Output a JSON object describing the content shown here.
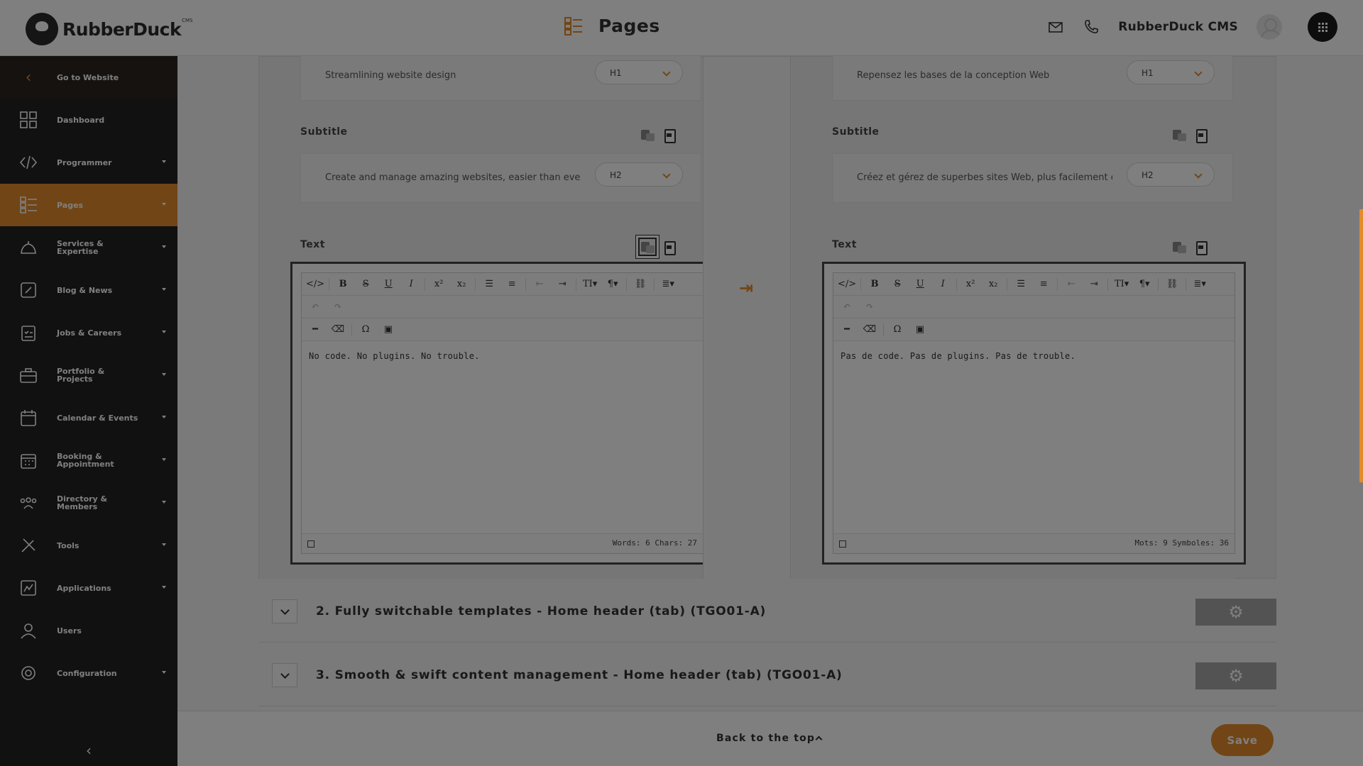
{
  "header": {
    "logo": "RubberDuck",
    "logo_sup": "CMS",
    "page_title": "Pages",
    "user_name": "RubberDuck CMS"
  },
  "sidebar": {
    "goto": "Go to Website",
    "items": [
      {
        "label": "Dashboard",
        "icon": "dashboard-icon",
        "expandable": false,
        "active": false
      },
      {
        "label": "Programmer",
        "icon": "code-icon",
        "expandable": true,
        "active": false
      },
      {
        "label": "Pages",
        "icon": "pages-icon",
        "expandable": true,
        "active": true
      },
      {
        "label": "Services & Expertise",
        "icon": "bell-icon",
        "expandable": true,
        "active": false
      },
      {
        "label": "Blog & News",
        "icon": "blog-icon",
        "expandable": true,
        "active": false
      },
      {
        "label": "Jobs & Careers",
        "icon": "clipboard-icon",
        "expandable": true,
        "active": false
      },
      {
        "label": "Portfolio & Projects",
        "icon": "briefcase-icon",
        "expandable": true,
        "active": false
      },
      {
        "label": "Calendar & Events",
        "icon": "calendar-icon",
        "expandable": true,
        "active": false
      },
      {
        "label": "Booking & Appointment",
        "icon": "booking-icon",
        "expandable": true,
        "active": false
      },
      {
        "label": "Directory & Members",
        "icon": "members-icon",
        "expandable": true,
        "active": false
      },
      {
        "label": "Tools",
        "icon": "tools-icon",
        "expandable": true,
        "active": false
      },
      {
        "label": "Applications",
        "icon": "applications-icon",
        "expandable": true,
        "active": false
      },
      {
        "label": "Users",
        "icon": "user-icon",
        "expandable": false,
        "active": false
      },
      {
        "label": "Configuration",
        "icon": "gear-icon",
        "expandable": true,
        "active": false
      }
    ]
  },
  "left": {
    "title_value": "Streamlining website design",
    "title_level": "H1",
    "subtitle_label": "Subtitle",
    "subtitle_value": "Create and manage amazing websites, easier than eve",
    "subtitle_level": "H2",
    "text_label": "Text",
    "text_content": "No code. No plugins. No trouble.",
    "count": "Words: 6   Chars: 27"
  },
  "right": {
    "title_value": "Repensez les bases de la conception Web",
    "title_level": "H1",
    "subtitle_label": "Subtitle",
    "subtitle_value": "Créez et gérez de superbes sites Web, plus facilement c",
    "subtitle_level": "H2",
    "text_label": "Text",
    "text_content": "Pas de code. Pas de plugins. Pas de trouble.",
    "count": "Mots: 9   Symboles: 36"
  },
  "sections": [
    {
      "title": "2. Fully switchable templates - Home header (tab) (TGO01-A)"
    },
    {
      "title": "3. Smooth & swift content management - Home header (tab) (TGO01-A)"
    }
  ],
  "footer": {
    "back_to_top": "Back to the top",
    "save": "Save"
  },
  "colors": {
    "accent": "#e38b2c",
    "sidebar": "#232323"
  }
}
